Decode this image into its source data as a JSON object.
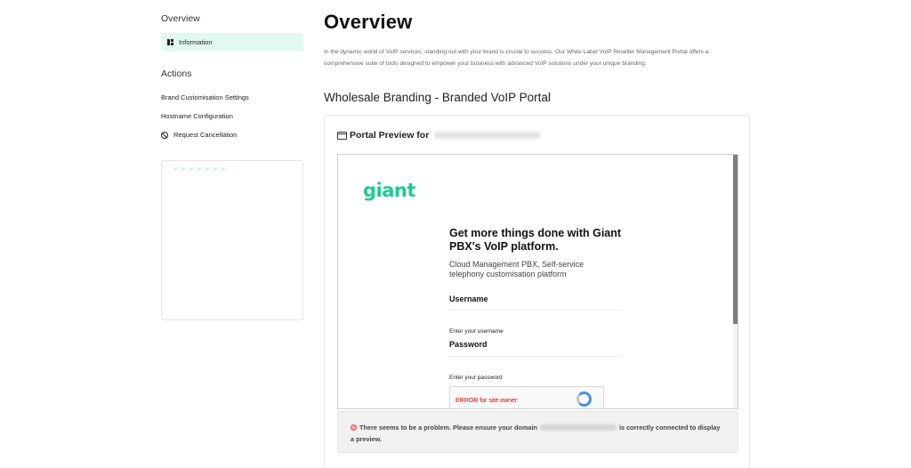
{
  "sidebar": {
    "overview_heading": "Overview",
    "information_label": "Information",
    "actions_heading": "Actions",
    "actions": [
      {
        "label": "Brand Customisation Settings"
      },
      {
        "label": "Hostname Configuration"
      },
      {
        "label": "Request Cancellation"
      }
    ]
  },
  "main": {
    "title": "Overview",
    "intro": "In the dynamic world of VoIP services, standing out with your brand is crucial to success. Our White Label VoIP Reseller Management Portal offers a comprehensive suite of tools designed to empower your business with advanced VoIP solutions under your unique branding.",
    "section_title": "Wholesale Branding - Branded VoIP Portal",
    "card": {
      "heading": "Portal Preview for"
    },
    "preview": {
      "logo_text": "giant",
      "headline": "Get more things done with Giant PBX's VoIP platform.",
      "subheadline": "Cloud Management PBX, Self-service telephony customisation platform",
      "username_label": "Username",
      "username_help": "Enter your username",
      "password_label": "Password",
      "password_help": "Enter your password",
      "recaptcha_error": "ERROR for site owner:"
    },
    "alert": {
      "text_before": "There seems to be a problem. Please ensure your domain",
      "text_after": "is correctly connected to display a preview."
    }
  },
  "colors": {
    "accent": "#1ecb95",
    "active_nav_bg": "#e3f8f3",
    "error": "#d60000"
  }
}
